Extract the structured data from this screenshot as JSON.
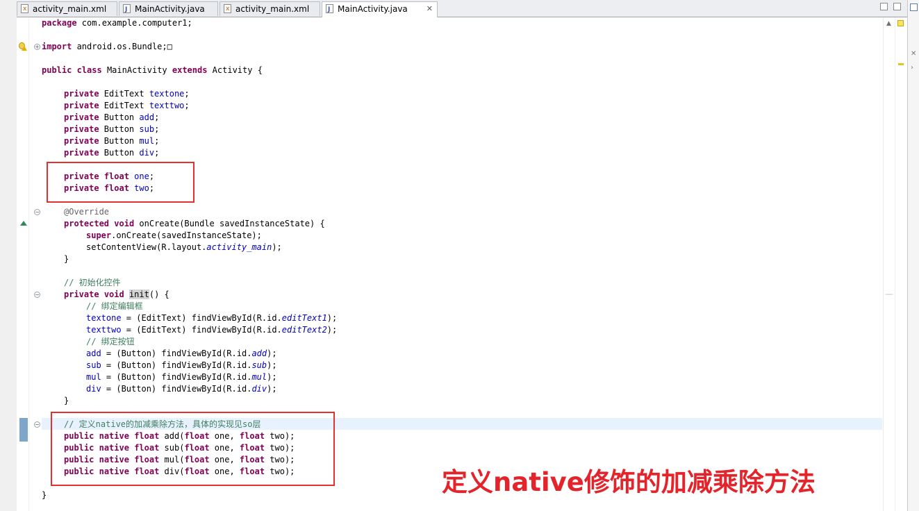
{
  "tabs": [
    {
      "label": "activity_main.xml",
      "type": "xml",
      "active": false
    },
    {
      "label": "MainActivity.java",
      "type": "java",
      "active": false
    },
    {
      "label": "activity_main.xml",
      "type": "xml",
      "active": false
    },
    {
      "label": "MainActivity.java",
      "type": "java",
      "active": true
    }
  ],
  "tab_close_glyph": "✕",
  "code": {
    "l01": {
      "a": "package",
      "b": " com.example.computer1;"
    },
    "l03": {
      "a": "import",
      "b": " android.os.Bundle;",
      "c": "□"
    },
    "l05": {
      "a": "public",
      "b": " ",
      "c": "class",
      "d": " MainActivity ",
      "e": "extends",
      "f": " Activity {"
    },
    "l07": {
      "a": "private",
      "b": " EditText ",
      "c": "textone",
      "d": ";"
    },
    "l08": {
      "a": "private",
      "b": " EditText ",
      "c": "texttwo",
      "d": ";"
    },
    "l09": {
      "a": "private",
      "b": " Button ",
      "c": "add",
      "d": ";"
    },
    "l10": {
      "a": "private",
      "b": " Button ",
      "c": "sub",
      "d": ";"
    },
    "l11": {
      "a": "private",
      "b": " Button ",
      "c": "mul",
      "d": ";"
    },
    "l12": {
      "a": "private",
      "b": " Button ",
      "c": "div",
      "d": ";"
    },
    "l14": {
      "a": "private",
      "b": " ",
      "c": "float",
      "d": " ",
      "e": "one",
      "f": ";"
    },
    "l15": {
      "a": "private",
      "b": " ",
      "c": "float",
      "d": " ",
      "e": "two",
      "f": ";"
    },
    "l17": {
      "a": "@Override"
    },
    "l18": {
      "a": "protected",
      "b": " ",
      "c": "void",
      "d": " onCreate(Bundle savedInstanceState) {"
    },
    "l19": {
      "a": "super",
      "b": ".onCreate(savedInstanceState);"
    },
    "l20": {
      "a": "setContentView(R.layout.",
      "b": "activity_main",
      "c": ");"
    },
    "l21": {
      "a": "}"
    },
    "l23": {
      "a": "// 初始化控件"
    },
    "l24": {
      "a": "private",
      "b": " ",
      "c": "void",
      "d": " ",
      "e": "init",
      "f": "() {"
    },
    "l25": {
      "a": "// 绑定编辑框"
    },
    "l26": {
      "a": "textone",
      "b": " = (EditText) findViewById(R.id.",
      "c": "editText1",
      "d": ");"
    },
    "l27": {
      "a": "texttwo",
      "b": " = (EditText) findViewById(R.id.",
      "c": "editText2",
      "d": ");"
    },
    "l28": {
      "a": "// 绑定按钮"
    },
    "l29": {
      "a": "add",
      "b": " = (Button) findViewById(R.id.",
      "c": "add",
      "d": ");"
    },
    "l30": {
      "a": "sub",
      "b": " = (Button) findViewById(R.id.",
      "c": "sub",
      "d": ");"
    },
    "l31": {
      "a": "mul",
      "b": " = (Button) findViewById(R.id.",
      "c": "mul",
      "d": ");"
    },
    "l32": {
      "a": "div",
      "b": " = (Button) findViewById(R.id.",
      "c": "div",
      "d": ");"
    },
    "l33": {
      "a": "}"
    },
    "l35": {
      "a": "// 定义native的加减乘除方法，具体的实现见so层"
    },
    "l36": {
      "a": "public",
      "b": " ",
      "c": "native",
      "d": " ",
      "e": "float",
      "f": " add(",
      "g": "float",
      "h": " one, ",
      "i": "float",
      "j": " two);"
    },
    "l37": {
      "a": "public",
      "b": " ",
      "c": "native",
      "d": " ",
      "e": "float",
      "f": " sub(",
      "g": "float",
      "h": " one, ",
      "i": "float",
      "j": " two);"
    },
    "l38": {
      "a": "public",
      "b": " ",
      "c": "native",
      "d": " ",
      "e": "float",
      "f": " mul(",
      "g": "float",
      "h": " one, ",
      "i": "float",
      "j": " two);"
    },
    "l39": {
      "a": "public",
      "b": " ",
      "c": "native",
      "d": " ",
      "e": "float",
      "f": " div(",
      "g": "float",
      "h": " one, ",
      "i": "float",
      "j": " two);"
    },
    "l41": {
      "a": "}"
    }
  },
  "annotation_text": "定义native修饰的加减乘除方法",
  "colors": {
    "keyword": "#7f0055",
    "field": "#0000c0",
    "comment": "#3f7f5f",
    "annotation_red": "#e3242b"
  }
}
